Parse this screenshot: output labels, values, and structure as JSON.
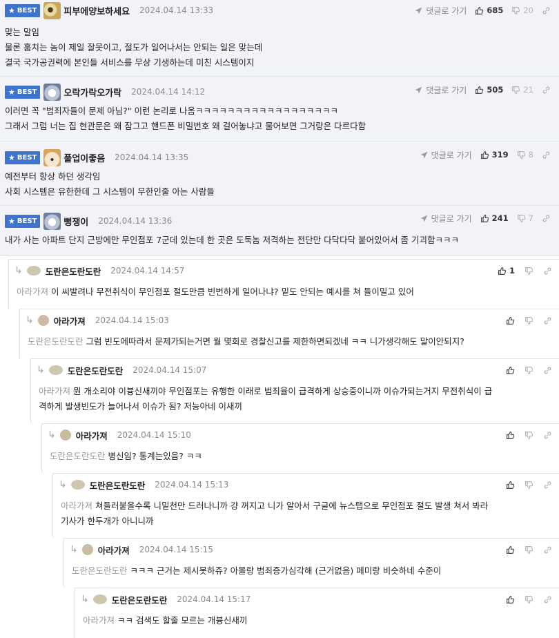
{
  "best_comments": [
    {
      "badge": "BEST",
      "nick": "피부에양보하세요",
      "date": "2024.04.14 13:33",
      "reply_label": "댓글로 가기",
      "up": "685",
      "down": "20",
      "lines": [
        "맞는 말임",
        "물론 훔치는 놈이 제일 잘못이고, 절도가 일어나서는 안되는 일은 맞는데",
        "결국 국가공권력에 본인들 서비스를 무상 기생하는데 미친 시스템이지"
      ]
    },
    {
      "badge": "BEST",
      "nick": "오락가락오가락",
      "date": "2024.04.14 14:12",
      "reply_label": "댓글로 가기",
      "up": "505",
      "down": "21",
      "lines": [
        "이러면 꼭 \"범죄자들이 문제 아님?\" 이런 논리로 나옴ㅋㅋㅋㅋㅋㅋㅋㅋㅋㅋㅋㅋㅋㅋㅋㅋㅋㅋ",
        "그래서 그럼 너는 집 현관문은 왜 잠그고 핸드폰 비밀번호 왜 걸어놓냐고 물어보면 그거랑은 다르다함"
      ]
    },
    {
      "badge": "BEST",
      "nick": "풀업이좋음",
      "date": "2024.04.14 13:35",
      "reply_label": "댓글로 가기",
      "up": "319",
      "down": "8",
      "lines": [
        "예전부터 항상 하던 생각임",
        "사회 시스템은 유한한데 그 시스템이 무한인줄 아는 사람들"
      ]
    },
    {
      "badge": "BEST",
      "nick": "뻥쟁이",
      "date": "2024.04.14 13:36",
      "reply_label": "댓글로 가기",
      "up": "241",
      "down": "7",
      "lines": [
        "내가 사는 아파트 단지 근방에만 무인점포 7군데 있는데 한 곳은 도둑놈 저격하는 전단만 다닥다닥 붙어있어서 좀 기괴함ㅋㅋㅋ"
      ]
    }
  ],
  "replies": [
    {
      "nick": "도란은도란도란",
      "date": "2024.04.14 14:57",
      "up": "1",
      "mention": "아라가져",
      "lines": [
        "이 씨발려나 무전취식이 무인점포 절도만큼 빈번하게 일어나냐? 밑도 안되는 예시를 쳐 들이밀고 있어"
      ]
    },
    {
      "nick": "아라가져",
      "date": "2024.04.14 15:03",
      "up": "",
      "mention": "도란은도란도란",
      "lines": [
        "그럼 빈도에따라서 문제가되는거면 월 몇회로 경찰신고를 제한하면되겠네 ㅋㅋ 니가생각해도 말이안되지?"
      ]
    },
    {
      "nick": "도란은도란도란",
      "date": "2024.04.14 15:07",
      "up": "",
      "mention": "아라가져",
      "lines": [
        "뭔 개소리야 이븅신새끼야 무인점포는 유행한 이래로 범죄율이 급격하게 상승중이니까 이슈가되는거지 무전취식이 급",
        "격하게 발생빈도가 늘어나서 이슈가 됨? 저능아네 이새끼"
      ]
    },
    {
      "nick": "아라가져",
      "date": "2024.04.14 15:10",
      "up": "",
      "mention": "도란은도란도란",
      "lines": [
        "병신임? 통계는있음? ㅋㅋ"
      ]
    },
    {
      "nick": "도란은도란도란",
      "date": "2024.04.14 15:13",
      "up": "",
      "mention": "아라가져",
      "lines": [
        "쳐들러붙을수록 니밑천만 드러나니까 걍 꺼지고 니가 알아서 구글에 뉴스탭으로 무인점포 절도 발생 쳐서 봐라",
        "기사가 한두개가 아니니까"
      ]
    },
    {
      "nick": "아라가져",
      "date": "2024.04.14 15:15",
      "up": "",
      "mention": "도란은도란도란",
      "lines": [
        "ㅋㅋㅋ 근거는 제시못하쥬? 아몰랑 범죄증가심각해 (근거없음) 페미랑 비슷하네 수준이"
      ]
    },
    {
      "nick": "도란은도란도란",
      "date": "2024.04.14 15:17",
      "up": "",
      "mention": "아라가져",
      "lines": [
        "ㅋㅋ 검색도 할줄 모르는 개븅신새끼"
      ]
    }
  ],
  "icons": {
    "badge": "star-icon",
    "reply": "send-icon",
    "up": "thumbs-up-icon",
    "down": "thumbs-down-icon",
    "link": "link-icon",
    "reply_arrow": "reply-arrow-icon"
  },
  "colors": {
    "best_bg": "#f1f3f8",
    "badge": "#3f74ce",
    "mention": "#999999"
  }
}
